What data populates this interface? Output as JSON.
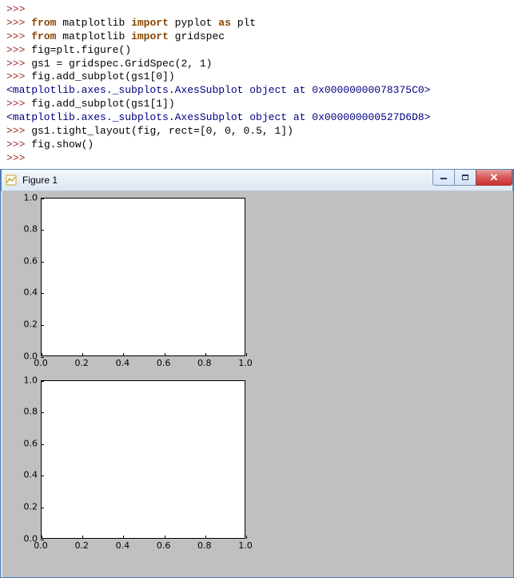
{
  "console_lines": [
    {
      "type": "prompt",
      "text": ">>>"
    },
    {
      "type": "code",
      "segments": [
        {
          "t": ">>> ",
          "c": "prompt"
        },
        {
          "t": "from",
          "c": "kw"
        },
        {
          "t": " matplotlib ",
          "c": "code"
        },
        {
          "t": "import",
          "c": "kw"
        },
        {
          "t": " pyplot ",
          "c": "code"
        },
        {
          "t": "as",
          "c": "kw"
        },
        {
          "t": " plt",
          "c": "code"
        }
      ]
    },
    {
      "type": "code",
      "segments": [
        {
          "t": ">>> ",
          "c": "prompt"
        },
        {
          "t": "from",
          "c": "kw"
        },
        {
          "t": " matplotlib ",
          "c": "code"
        },
        {
          "t": "import",
          "c": "kw"
        },
        {
          "t": " gridspec",
          "c": "code"
        }
      ]
    },
    {
      "type": "code",
      "segments": [
        {
          "t": ">>> ",
          "c": "prompt"
        },
        {
          "t": "fig=plt.figure()",
          "c": "code"
        }
      ]
    },
    {
      "type": "code",
      "segments": [
        {
          "t": ">>> ",
          "c": "prompt"
        },
        {
          "t": "gs1 = gridspec.GridSpec(2, 1)",
          "c": "code"
        }
      ]
    },
    {
      "type": "code",
      "segments": [
        {
          "t": ">>> ",
          "c": "prompt"
        },
        {
          "t": "fig.add_subplot(gs1[0])",
          "c": "code"
        }
      ]
    },
    {
      "type": "output",
      "text": "<matplotlib.axes._subplots.AxesSubplot object at 0x00000000078375C0>"
    },
    {
      "type": "code",
      "segments": [
        {
          "t": ">>> ",
          "c": "prompt"
        },
        {
          "t": "fig.add_subplot(gs1[1])",
          "c": "code"
        }
      ]
    },
    {
      "type": "output",
      "text": "<matplotlib.axes._subplots.AxesSubplot object at 0x000000000527D6D8>"
    },
    {
      "type": "code",
      "segments": [
        {
          "t": ">>> ",
          "c": "prompt"
        },
        {
          "t": "gs1.tight_layout(fig, rect=[0, 0, 0.5, 1])",
          "c": "code"
        }
      ]
    },
    {
      "type": "code",
      "segments": [
        {
          "t": ">>> ",
          "c": "prompt"
        },
        {
          "t": "fig.show()",
          "c": "code"
        }
      ]
    },
    {
      "type": "prompt",
      "text": ">>>"
    }
  ],
  "window": {
    "title": "Figure 1"
  },
  "chart_data": [
    {
      "type": "line",
      "title": "",
      "xlabel": "",
      "ylabel": "",
      "xlim": [
        0.0,
        1.0
      ],
      "ylim": [
        0.0,
        1.0
      ],
      "xticks": [
        "0.0",
        "0.2",
        "0.4",
        "0.6",
        "0.8",
        "1.0"
      ],
      "yticks": [
        "0.0",
        "0.2",
        "0.4",
        "0.6",
        "0.8",
        "1.0"
      ],
      "series": []
    },
    {
      "type": "line",
      "title": "",
      "xlabel": "",
      "ylabel": "",
      "xlim": [
        0.0,
        1.0
      ],
      "ylim": [
        0.0,
        1.0
      ],
      "xticks": [
        "0.0",
        "0.2",
        "0.4",
        "0.6",
        "0.8",
        "1.0"
      ],
      "yticks": [
        "0.0",
        "0.2",
        "0.4",
        "0.6",
        "0.8",
        "1.0"
      ],
      "series": []
    }
  ]
}
